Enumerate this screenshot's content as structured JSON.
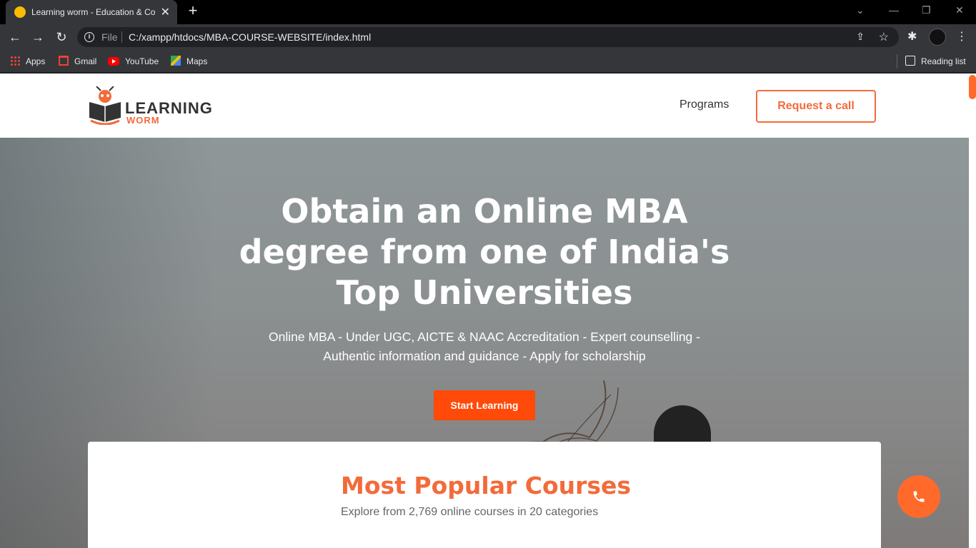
{
  "browser": {
    "tab": {
      "title": "Learning worm - Education & Co"
    },
    "address_bar": {
      "scheme_label": "File",
      "url": "C:/xampp/htdocs/MBA-COURSE-WEBSITE/index.html"
    },
    "bookmarks": [
      {
        "label": "Apps",
        "icon": "apps-icon"
      },
      {
        "label": "Gmail",
        "icon": "gmail-icon"
      },
      {
        "label": "YouTube",
        "icon": "youtube-icon"
      },
      {
        "label": "Maps",
        "icon": "maps-icon"
      }
    ],
    "reading_list": "Reading list"
  },
  "site": {
    "logo": {
      "line1": "LEARNING",
      "line2": "WORM"
    },
    "nav": {
      "programs": "Programs",
      "cta": "Request a call"
    },
    "hero": {
      "title": "Obtain an Online MBA degree from one of India's Top Universities",
      "subtitle": "Online MBA - Under UGC, AICTE & NAAC Accreditation - Expert counselling - Authentic information and guidance - Apply for scholarship",
      "button": "Start Learning"
    },
    "courses": {
      "title": "Most Popular Courses",
      "subtitle": "Explore from 2,769 online courses in 20 categories"
    }
  },
  "colors": {
    "accent": "#f26b3a",
    "button": "#ff4a0a"
  }
}
